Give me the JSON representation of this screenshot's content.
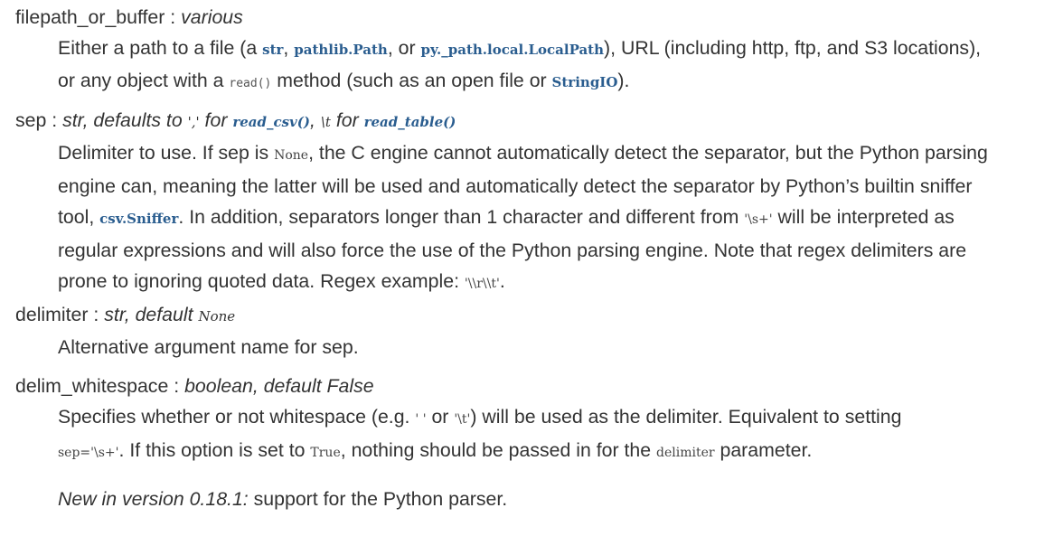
{
  "params": {
    "p1": {
      "name": "filepath_or_buffer",
      "sep": " : ",
      "type": "various",
      "d1": "Either a path to a file (a ",
      "c1": "str",
      "d2": ", ",
      "c2": "pathlib.Path",
      "d3": ", or ",
      "c3": "py._path.local.LocalPath",
      "d4": "), URL (including http, ftp, and S3 locations),",
      "d5": "or any object with a ",
      "c4": "read()",
      "d6": " method (such as an open file or ",
      "c5": "StringIO",
      "d7": ")."
    },
    "p2": {
      "name": "sep",
      "sep": " : ",
      "type1": "str, defaults to ",
      "lit1": "','",
      "type2": " for ",
      "ref1": "read_csv()",
      "type3": ", ",
      "lit2": "\\t",
      "type4": " for ",
      "ref2": "read_table()",
      "l1a": "Delimiter to use. If sep is ",
      "l1c": "None",
      "l1b": ", the C engine cannot automatically detect the separator, but the Python parsing",
      "l2": "engine can, meaning the latter will be used and automatically detect the separator by Python’s builtin sniffer",
      "l3a": "tool, ",
      "l3c": "csv.Sniffer",
      "l3b": ". In addition, separators longer than 1 character and different from ",
      "l3d": "'\\s+'",
      "l3e": " will be interpreted as",
      "l4": "regular expressions and will also force the use of the Python parsing engine. Note that regex delimiters are",
      "l5a": "prone to ignoring quoted data. Regex example: ",
      "l5c": "'\\\\r\\\\t'",
      "l5b": "."
    },
    "p3": {
      "name": "delimiter",
      "sep": " : ",
      "type": "str, default ",
      "default": "None",
      "desc": "Alternative argument name for sep."
    },
    "p4": {
      "name": "delim_whitespace",
      "sep": " : ",
      "type": "boolean, default False",
      "l1a": "Specifies whether or not whitespace (e.g. ",
      "l1c1": "' '",
      "l1b": " or ",
      "l1c2": "'\\t'",
      "l1d": ") will be used as the delimiter. Equivalent to setting",
      "l2c1": "sep='\\s+'",
      "l2a": ". If this option is set to ",
      "l2c2": "True",
      "l2b": ", nothing should be passed in for the ",
      "l2c3": "delimiter",
      "l2d": " parameter."
    }
  },
  "version_note": {
    "label": "New in version 0.18.1:",
    "text": " support for the Python parser."
  },
  "colors": {
    "text": "#333333",
    "xref": "#2a5d8f"
  }
}
